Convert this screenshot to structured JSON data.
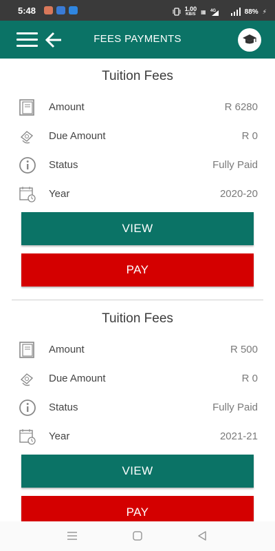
{
  "status_bar": {
    "time": "5:48",
    "speed": "1.00",
    "speed_unit": "KB/S",
    "battery": "88%"
  },
  "app_bar": {
    "title": "FEES PAYMENTS"
  },
  "fees": [
    {
      "title": "Tuition Fees",
      "amount_label": "Amount",
      "amount_value": "R 6280",
      "due_label": "Due Amount",
      "due_value": "R 0",
      "status_label": "Status",
      "status_value": "Fully Paid",
      "year_label": "Year",
      "year_value": "2020-20",
      "view_label": "VIEW",
      "pay_label": "PAY"
    },
    {
      "title": "Tuition Fees",
      "amount_label": "Amount",
      "amount_value": "R 500",
      "due_label": "Due Amount",
      "due_value": "R 0",
      "status_label": "Status",
      "status_value": "Fully Paid",
      "year_label": "Year",
      "year_value": "2021-21",
      "view_label": "VIEW",
      "pay_label": "PAY"
    }
  ],
  "colors": {
    "primary": "#0b7366",
    "pay": "#d40000",
    "status_bar": "#3a3a3a"
  },
  "icons": {
    "amount": "ledger-icon",
    "due": "money-hand-icon",
    "status": "info-icon",
    "year": "calendar-clock-icon"
  }
}
